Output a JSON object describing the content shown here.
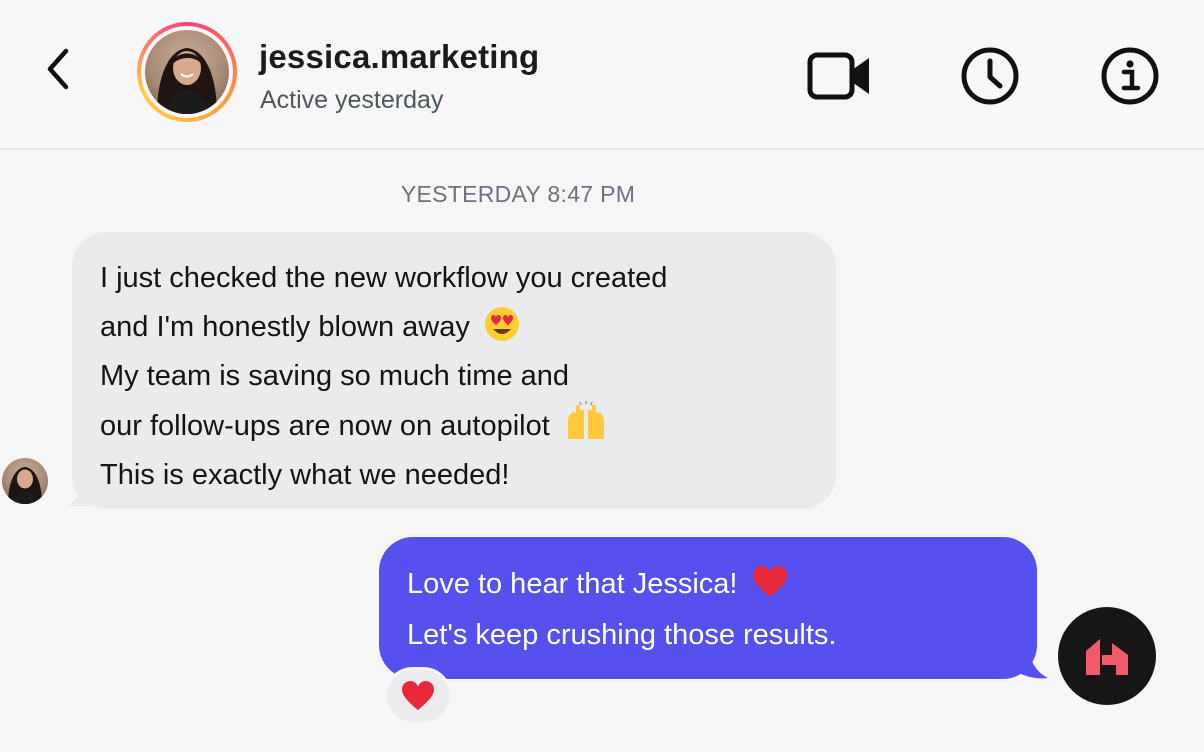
{
  "header": {
    "username": "jessica.marketing",
    "status": "Active yesterday",
    "icons": [
      "back-chevron-icon",
      "video-camera-icon",
      "clock-icon",
      "info-icon"
    ]
  },
  "conversation": {
    "timestamp": "YESTERDAY 8:47 PM",
    "incoming": {
      "lines": [
        "I just checked the new workflow you created",
        "and I'm honestly blown away",
        "My team is saving so much time and",
        "our follow-ups are now on autopilot",
        "This is exactly what we needed!"
      ],
      "emojis": [
        "heart-eyes-emoji",
        "raised-hands-emoji"
      ]
    },
    "outgoing": {
      "lines": [
        "Love to hear that Jessica!",
        "Let's keep crushing those results."
      ],
      "emojis": [
        "red-heart-emoji"
      ],
      "reaction": "red-heart-emoji"
    }
  },
  "colors": {
    "outgoing_bubble": "#5550ee",
    "incoming_bubble": "#ebebed",
    "background": "#f6f6f7",
    "brand_logo_bg": "#161616",
    "brand_logo_mark": "#f25a6a"
  }
}
